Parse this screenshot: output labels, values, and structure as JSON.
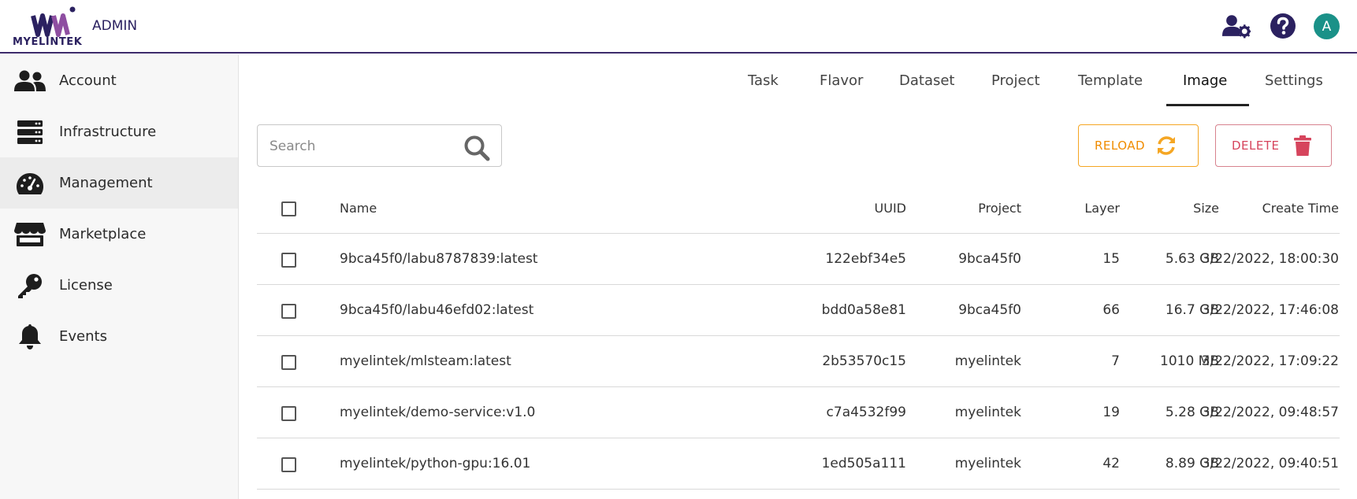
{
  "header": {
    "logo_text": "MYELINTEK",
    "admin_label": "ADMIN",
    "avatar_letter": "A",
    "accent_color": "#3d2b6b",
    "avatar_color": "#1a9188"
  },
  "sidebar": {
    "items": [
      {
        "label": "Account",
        "icon": "users-icon"
      },
      {
        "label": "Infrastructure",
        "icon": "server-icon"
      },
      {
        "label": "Management",
        "icon": "gauge-icon",
        "active": true
      },
      {
        "label": "Marketplace",
        "icon": "store-icon"
      },
      {
        "label": "License",
        "icon": "key-icon"
      },
      {
        "label": "Events",
        "icon": "bell-icon"
      }
    ]
  },
  "tabs": {
    "items": [
      "Task",
      "Flavor",
      "Dataset",
      "Project",
      "Template",
      "Image",
      "Settings"
    ],
    "active": "Image"
  },
  "toolbar": {
    "search_placeholder": "Search",
    "search_value": "",
    "reload_label": "RELOAD",
    "delete_label": "DELETE",
    "reload_color": "#f08c00",
    "delete_color": "#d6455d"
  },
  "table": {
    "columns": [
      "Name",
      "UUID",
      "Project",
      "Layer",
      "Size",
      "Create Time"
    ],
    "rows": [
      {
        "name": "9bca45f0/labu8787839:latest",
        "uuid": "122ebf34e5",
        "project": "9bca45f0",
        "layer": "15",
        "size": "5.63 GB",
        "create_time": "3/22/2022, 18:00:30"
      },
      {
        "name": "9bca45f0/labu46efd02:latest",
        "uuid": "bdd0a58e81",
        "project": "9bca45f0",
        "layer": "66",
        "size": "16.7 GB",
        "create_time": "3/22/2022, 17:46:08"
      },
      {
        "name": "myelintek/mlsteam:latest",
        "uuid": "2b53570c15",
        "project": "myelintek",
        "layer": "7",
        "size": "1010 MB",
        "create_time": "3/22/2022, 17:09:22"
      },
      {
        "name": "myelintek/demo-service:v1.0",
        "uuid": "c7a4532f99",
        "project": "myelintek",
        "layer": "19",
        "size": "5.28 GB",
        "create_time": "3/22/2022, 09:48:57"
      },
      {
        "name": "myelintek/python-gpu:16.01",
        "uuid": "1ed505a111",
        "project": "myelintek",
        "layer": "42",
        "size": "8.89 GB",
        "create_time": "3/22/2022, 09:40:51"
      }
    ]
  }
}
